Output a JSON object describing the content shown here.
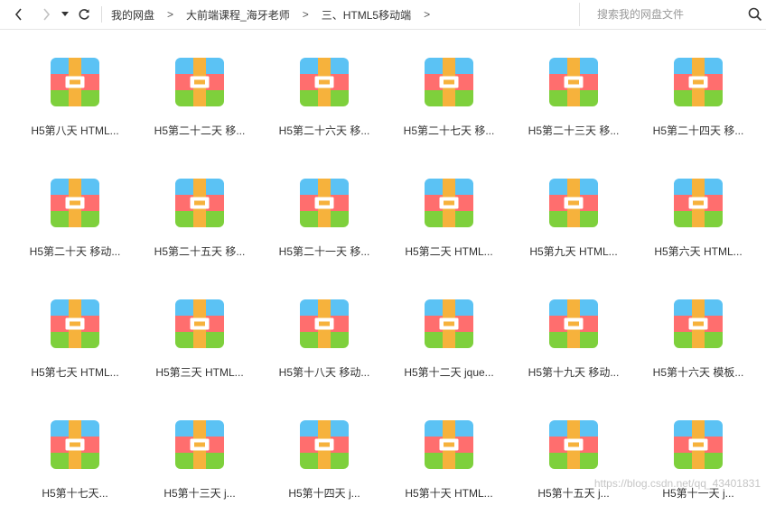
{
  "toolbar": {
    "back_icon": "chevron-left-icon",
    "forward_icon": "chevron-right-icon",
    "history_icon": "caret-down-icon",
    "refresh_icon": "refresh-icon",
    "breadcrumb": [
      "我的网盘",
      "大前端课程_海牙老师",
      "三、HTML5移动端"
    ],
    "breadcrumb_separator": ">"
  },
  "search": {
    "placeholder": "搜索我的网盘文件",
    "icon": "search-icon"
  },
  "files": [
    {
      "name": "H5第八天 HTML..."
    },
    {
      "name": "H5第二十二天 移..."
    },
    {
      "name": "H5第二十六天 移..."
    },
    {
      "name": "H5第二十七天 移..."
    },
    {
      "name": "H5第二十三天 移..."
    },
    {
      "name": "H5第二十四天 移..."
    },
    {
      "name": "H5第二十天 移动..."
    },
    {
      "name": "H5第二十五天 移..."
    },
    {
      "name": "H5第二十一天 移..."
    },
    {
      "name": "H5第二天 HTML..."
    },
    {
      "name": "H5第九天 HTML..."
    },
    {
      "name": "H5第六天 HTML..."
    },
    {
      "name": "H5第七天 HTML..."
    },
    {
      "name": "H5第三天 HTML..."
    },
    {
      "name": "H5第十八天 移动..."
    },
    {
      "name": "H5第十二天 jque..."
    },
    {
      "name": "H5第十九天 移动..."
    },
    {
      "name": "H5第十六天 模板..."
    },
    {
      "name": "H5第十七天..."
    },
    {
      "name": "H5第十三天 j..."
    },
    {
      "name": "H5第十四天 j..."
    },
    {
      "name": "H5第十天 HTML..."
    },
    {
      "name": "H5第十五天 j..."
    },
    {
      "name": "H5第十一天 j..."
    }
  ],
  "file_icon": "archive-icon",
  "archive_colors": {
    "top": "#5bc2f4",
    "middle": "#ff6e6e",
    "bottom": "#7ed03c",
    "strap": "#f6b23c",
    "buckle": "#ffffff"
  },
  "watermark": "https://blog.csdn.net/qq_43401831"
}
